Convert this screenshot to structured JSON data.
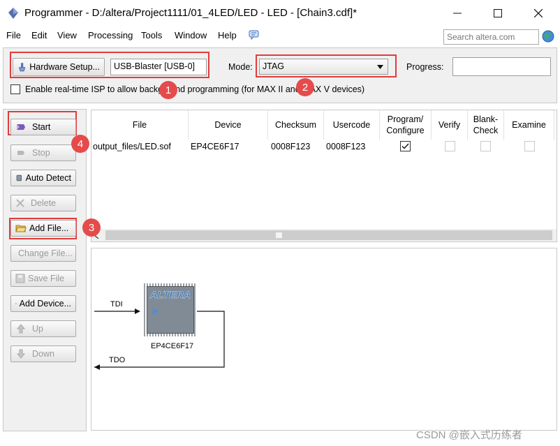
{
  "window": {
    "title": "Programmer - D:/altera/Project1111/01_4LED/LED - LED - [Chain3.cdf]*"
  },
  "menu": [
    "File",
    "Edit",
    "View",
    "Processing",
    "Tools",
    "Window",
    "Help"
  ],
  "search": {
    "placeholder": "Search altera.com"
  },
  "setup": {
    "hardware_button": "Hardware Setup...",
    "hardware_value": "USB-Blaster [USB-0]",
    "mode_label": "Mode:",
    "mode_value": "JTAG",
    "progress_label": "Progress:",
    "isp_label": "Enable real-time ISP to allow background programming (for MAX II and MAX V devices)"
  },
  "buttons": {
    "start": "Start",
    "stop": "Stop",
    "auto_detect": "Auto Detect",
    "delete": "Delete",
    "add_file": "Add File...",
    "change_file": "Change File...",
    "save_file": "Save File",
    "add_device": "Add Device...",
    "up": "Up",
    "down": "Down"
  },
  "table": {
    "columns": [
      "File",
      "Device",
      "Checksum",
      "Usercode",
      "Program/ Configure",
      "Verify",
      "Blank- Check",
      "Examine"
    ],
    "rows": [
      {
        "file": "output_files/LED.sof",
        "device": "EP4CE6F17",
        "checksum": "0008F123",
        "usercode": "0008F123",
        "program_configure": true,
        "verify": false,
        "blank_check": false,
        "examine": false
      }
    ]
  },
  "chain": {
    "tdi": "TDI",
    "tdo": "TDO",
    "chip_logo": "ALTERA",
    "device": "EP4CE6F17"
  },
  "annotations": [
    "1",
    "2",
    "3",
    "4"
  ],
  "watermark": "CSDN @嵌入式历练者",
  "colors": {
    "highlight": "#e03c3c",
    "panel": "#f0f0f0",
    "chip": "#7f8a94",
    "logo": "#2b6cb0"
  }
}
